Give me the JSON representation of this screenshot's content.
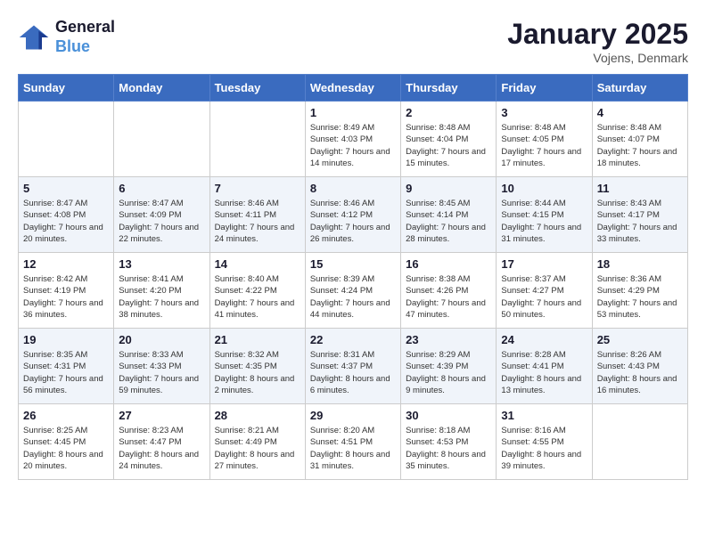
{
  "header": {
    "logo_line1": "General",
    "logo_line2": "Blue",
    "month": "January 2025",
    "location": "Vojens, Denmark"
  },
  "days_of_week": [
    "Sunday",
    "Monday",
    "Tuesday",
    "Wednesday",
    "Thursday",
    "Friday",
    "Saturday"
  ],
  "weeks": [
    [
      {
        "day": "",
        "info": ""
      },
      {
        "day": "",
        "info": ""
      },
      {
        "day": "",
        "info": ""
      },
      {
        "day": "1",
        "info": "Sunrise: 8:49 AM\nSunset: 4:03 PM\nDaylight: 7 hours\nand 14 minutes."
      },
      {
        "day": "2",
        "info": "Sunrise: 8:48 AM\nSunset: 4:04 PM\nDaylight: 7 hours\nand 15 minutes."
      },
      {
        "day": "3",
        "info": "Sunrise: 8:48 AM\nSunset: 4:05 PM\nDaylight: 7 hours\nand 17 minutes."
      },
      {
        "day": "4",
        "info": "Sunrise: 8:48 AM\nSunset: 4:07 PM\nDaylight: 7 hours\nand 18 minutes."
      }
    ],
    [
      {
        "day": "5",
        "info": "Sunrise: 8:47 AM\nSunset: 4:08 PM\nDaylight: 7 hours\nand 20 minutes."
      },
      {
        "day": "6",
        "info": "Sunrise: 8:47 AM\nSunset: 4:09 PM\nDaylight: 7 hours\nand 22 minutes."
      },
      {
        "day": "7",
        "info": "Sunrise: 8:46 AM\nSunset: 4:11 PM\nDaylight: 7 hours\nand 24 minutes."
      },
      {
        "day": "8",
        "info": "Sunrise: 8:46 AM\nSunset: 4:12 PM\nDaylight: 7 hours\nand 26 minutes."
      },
      {
        "day": "9",
        "info": "Sunrise: 8:45 AM\nSunset: 4:14 PM\nDaylight: 7 hours\nand 28 minutes."
      },
      {
        "day": "10",
        "info": "Sunrise: 8:44 AM\nSunset: 4:15 PM\nDaylight: 7 hours\nand 31 minutes."
      },
      {
        "day": "11",
        "info": "Sunrise: 8:43 AM\nSunset: 4:17 PM\nDaylight: 7 hours\nand 33 minutes."
      }
    ],
    [
      {
        "day": "12",
        "info": "Sunrise: 8:42 AM\nSunset: 4:19 PM\nDaylight: 7 hours\nand 36 minutes."
      },
      {
        "day": "13",
        "info": "Sunrise: 8:41 AM\nSunset: 4:20 PM\nDaylight: 7 hours\nand 38 minutes."
      },
      {
        "day": "14",
        "info": "Sunrise: 8:40 AM\nSunset: 4:22 PM\nDaylight: 7 hours\nand 41 minutes."
      },
      {
        "day": "15",
        "info": "Sunrise: 8:39 AM\nSunset: 4:24 PM\nDaylight: 7 hours\nand 44 minutes."
      },
      {
        "day": "16",
        "info": "Sunrise: 8:38 AM\nSunset: 4:26 PM\nDaylight: 7 hours\nand 47 minutes."
      },
      {
        "day": "17",
        "info": "Sunrise: 8:37 AM\nSunset: 4:27 PM\nDaylight: 7 hours\nand 50 minutes."
      },
      {
        "day": "18",
        "info": "Sunrise: 8:36 AM\nSunset: 4:29 PM\nDaylight: 7 hours\nand 53 minutes."
      }
    ],
    [
      {
        "day": "19",
        "info": "Sunrise: 8:35 AM\nSunset: 4:31 PM\nDaylight: 7 hours\nand 56 minutes."
      },
      {
        "day": "20",
        "info": "Sunrise: 8:33 AM\nSunset: 4:33 PM\nDaylight: 7 hours\nand 59 minutes."
      },
      {
        "day": "21",
        "info": "Sunrise: 8:32 AM\nSunset: 4:35 PM\nDaylight: 8 hours\nand 2 minutes."
      },
      {
        "day": "22",
        "info": "Sunrise: 8:31 AM\nSunset: 4:37 PM\nDaylight: 8 hours\nand 6 minutes."
      },
      {
        "day": "23",
        "info": "Sunrise: 8:29 AM\nSunset: 4:39 PM\nDaylight: 8 hours\nand 9 minutes."
      },
      {
        "day": "24",
        "info": "Sunrise: 8:28 AM\nSunset: 4:41 PM\nDaylight: 8 hours\nand 13 minutes."
      },
      {
        "day": "25",
        "info": "Sunrise: 8:26 AM\nSunset: 4:43 PM\nDaylight: 8 hours\nand 16 minutes."
      }
    ],
    [
      {
        "day": "26",
        "info": "Sunrise: 8:25 AM\nSunset: 4:45 PM\nDaylight: 8 hours\nand 20 minutes."
      },
      {
        "day": "27",
        "info": "Sunrise: 8:23 AM\nSunset: 4:47 PM\nDaylight: 8 hours\nand 24 minutes."
      },
      {
        "day": "28",
        "info": "Sunrise: 8:21 AM\nSunset: 4:49 PM\nDaylight: 8 hours\nand 27 minutes."
      },
      {
        "day": "29",
        "info": "Sunrise: 8:20 AM\nSunset: 4:51 PM\nDaylight: 8 hours\nand 31 minutes."
      },
      {
        "day": "30",
        "info": "Sunrise: 8:18 AM\nSunset: 4:53 PM\nDaylight: 8 hours\nand 35 minutes."
      },
      {
        "day": "31",
        "info": "Sunrise: 8:16 AM\nSunset: 4:55 PM\nDaylight: 8 hours\nand 39 minutes."
      },
      {
        "day": "",
        "info": ""
      }
    ]
  ]
}
